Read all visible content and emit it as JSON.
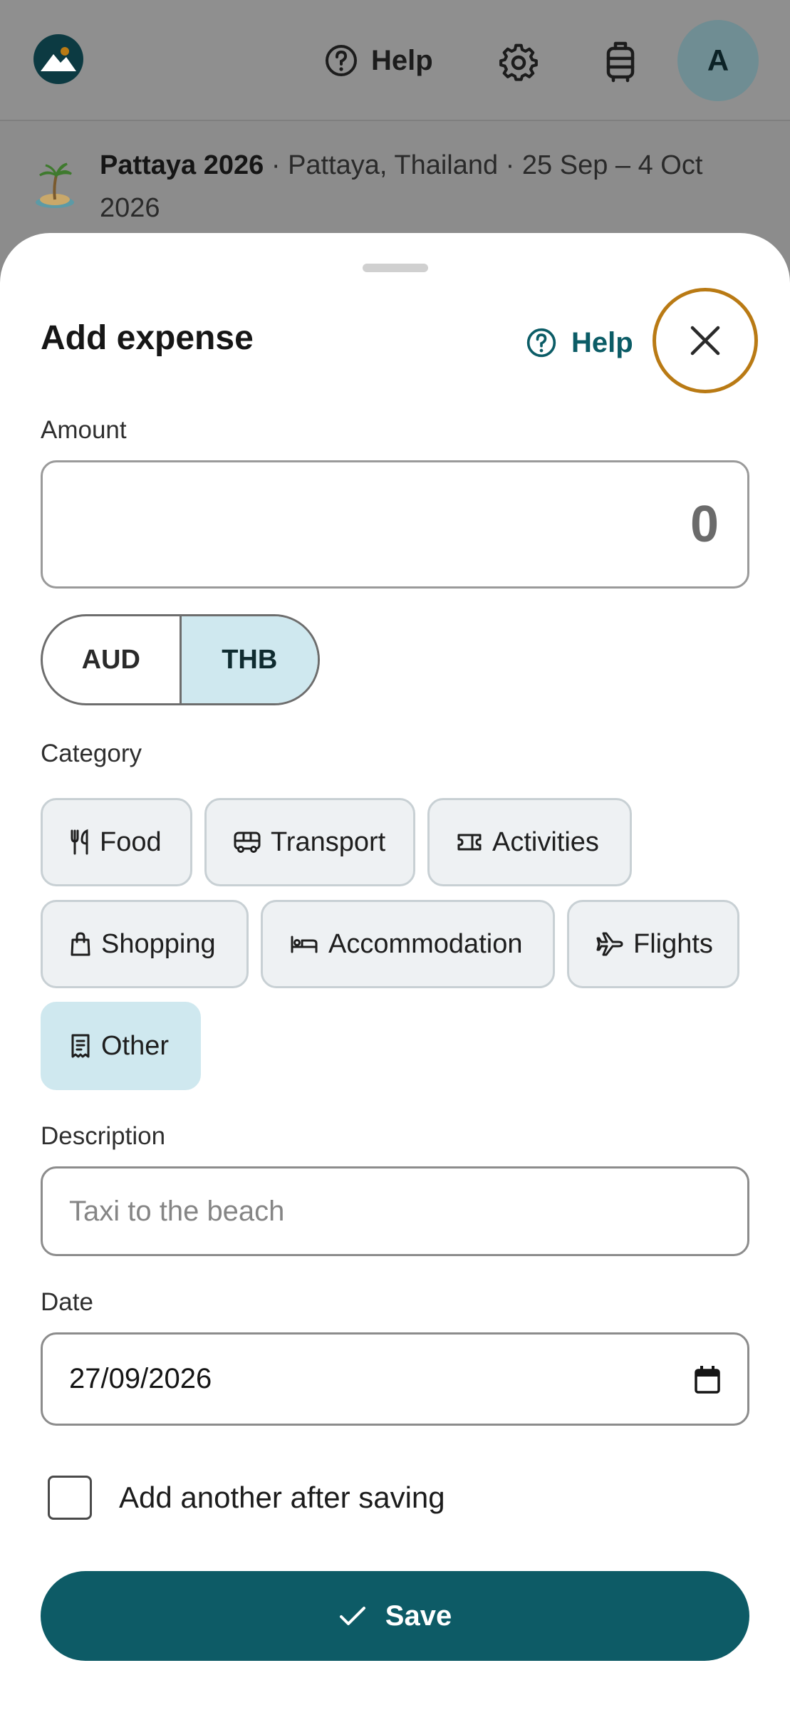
{
  "app": {
    "header": {
      "help_label": "Help",
      "avatar_initial": "A",
      "icons": [
        "logo-icon",
        "help-circle-icon",
        "gear-icon",
        "luggage-icon"
      ]
    },
    "trip": {
      "emoji_icon": "island-icon",
      "name": "Pattaya 2026",
      "details": " · Pattaya, Thailand · 25 Sep – 4 Oct 2026"
    }
  },
  "sheet": {
    "title": "Add expense",
    "help_label": "Help",
    "close_icon": "close-icon",
    "amount": {
      "label": "Amount",
      "value": "0"
    },
    "currency": {
      "options": [
        "AUD",
        "THB"
      ],
      "selected": "THB"
    },
    "category": {
      "label": "Category",
      "options": [
        {
          "label": "Food",
          "icon": "fork-knife-icon"
        },
        {
          "label": "Transport",
          "icon": "bus-icon"
        },
        {
          "label": "Activities",
          "icon": "ticket-icon"
        },
        {
          "label": "Shopping",
          "icon": "shopping-bag-icon"
        },
        {
          "label": "Accommodation",
          "icon": "bed-icon"
        },
        {
          "label": "Flights",
          "icon": "plane-icon"
        },
        {
          "label": "Other",
          "icon": "receipt-icon"
        }
      ],
      "selected": "Other"
    },
    "description": {
      "label": "Description",
      "placeholder": "Taxi to the beach"
    },
    "date": {
      "label": "Date",
      "value": "27/09/2026",
      "icon": "calendar-icon"
    },
    "add_another": {
      "label": "Add another after saving",
      "checked": false
    },
    "save": {
      "label": "Save",
      "icon": "check-icon"
    }
  },
  "colors": {
    "accent": "#0d5b66",
    "selected_bg": "#cfe8ef",
    "focus_ring": "#b97a14",
    "overlay": "#8c8c8c"
  }
}
